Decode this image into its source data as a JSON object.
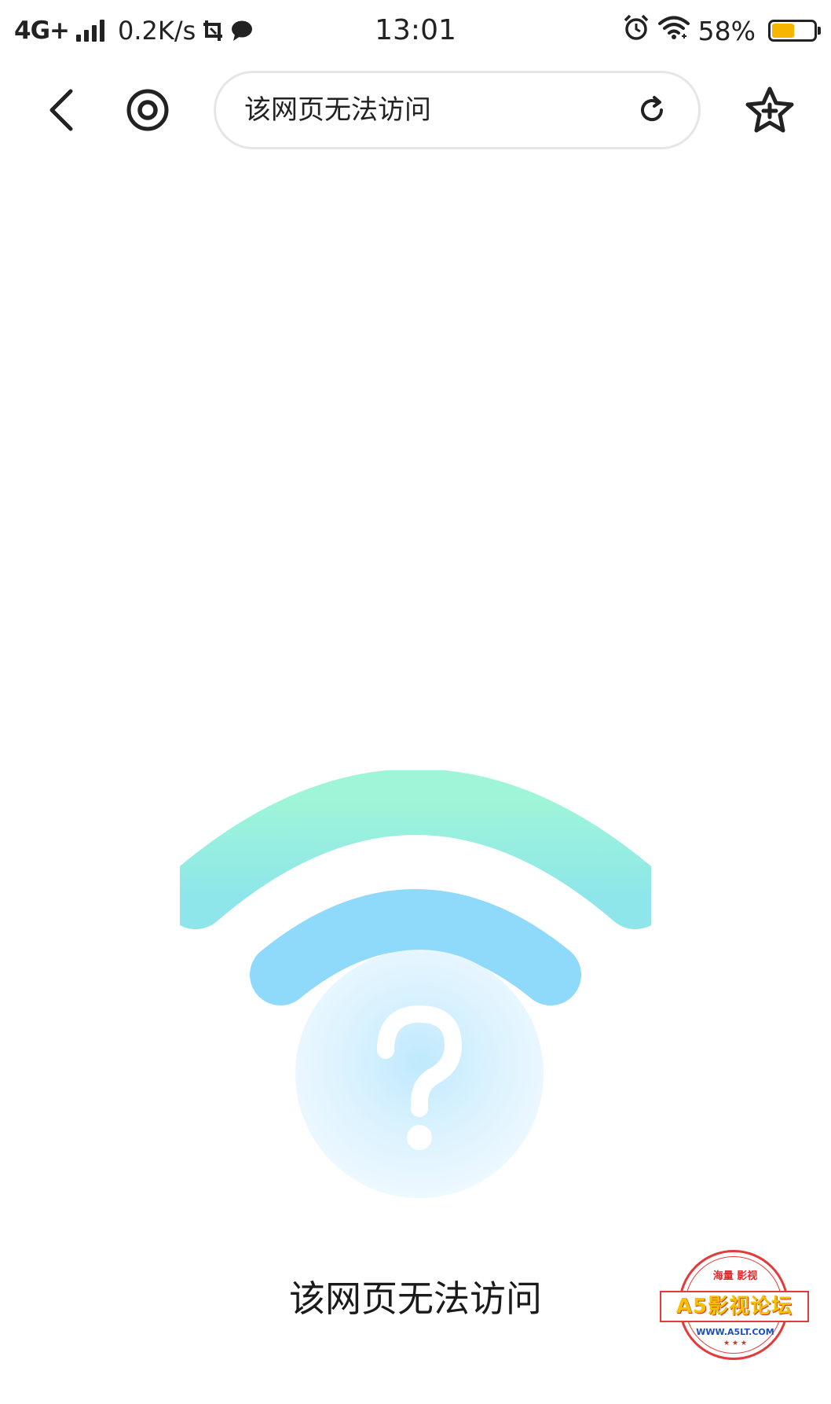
{
  "status_bar": {
    "network": "4G+",
    "speed": "0.2K/s",
    "time": "13:01",
    "battery_percent": "58%",
    "battery_level": 0.58,
    "battery_color": "#f7b500",
    "icons": [
      "signal-icon",
      "screenshot-icon",
      "message-icon",
      "alarm-icon",
      "wifi-icon",
      "battery-icon"
    ]
  },
  "toolbar": {
    "address_text": "该网页无法访问",
    "icons": [
      "back-arrow-icon",
      "target-icon",
      "reload-icon",
      "star-plus-icon"
    ]
  },
  "error_page": {
    "message": "该网页无法访问",
    "illustration_icon": "wifi-question-icon",
    "colors": {
      "outer_arc_top": "#9ef5d8",
      "outer_arc_bottom": "#8ee6ea",
      "inner_arc": "#8fd9fb",
      "bubble": "#eef8ff",
      "bubble_glow": "#bfe9fd"
    }
  },
  "watermark": {
    "top_text": "海量 影视",
    "banner_text": "A5影视论坛",
    "url_text": "WWW.A5LT.COM"
  }
}
